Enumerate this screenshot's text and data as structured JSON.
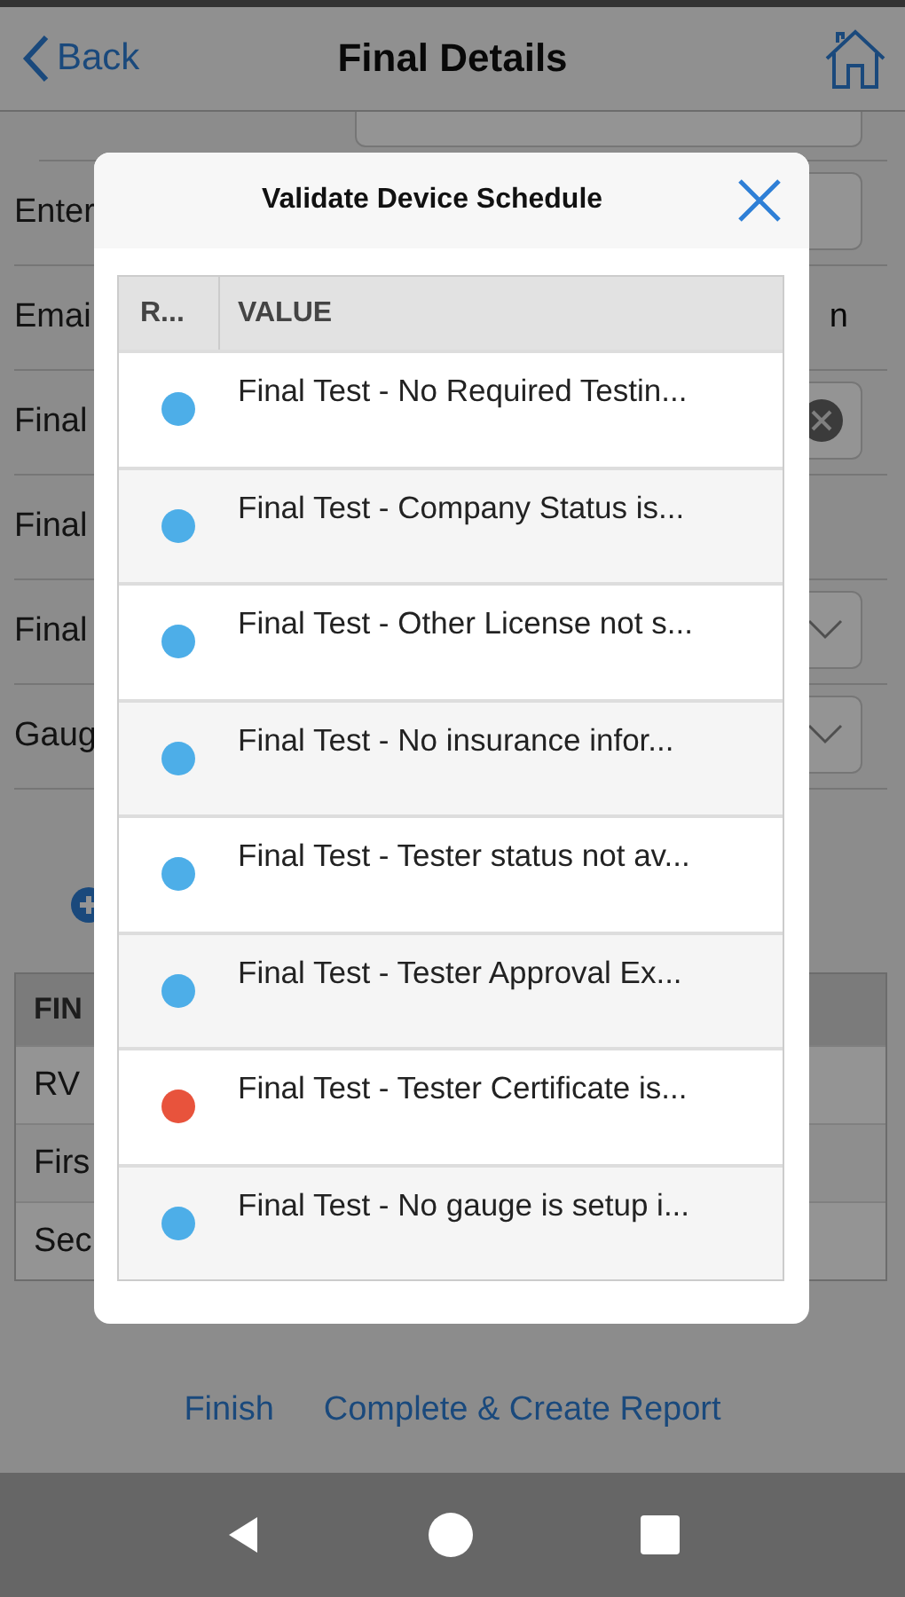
{
  "header": {
    "back": "Back",
    "title": "Final Details"
  },
  "form_rows": [
    {
      "label": "Enter",
      "kind": "field"
    },
    {
      "label": "Emai",
      "kind": "text",
      "value": "n"
    },
    {
      "label": "Final",
      "kind": "clearable"
    },
    {
      "label": "Final",
      "kind": "none"
    },
    {
      "label": "Final",
      "kind": "select"
    },
    {
      "label": "Gaug",
      "kind": "select"
    }
  ],
  "table": {
    "columns": [
      "FIN"
    ],
    "rows": [
      "RV",
      "Firs",
      "Sec"
    ]
  },
  "footer_links": [
    "Finish",
    "Complete & Create Report"
  ],
  "dialog": {
    "title": "Validate Device Schedule",
    "columns": [
      "R...",
      "VALUE"
    ],
    "rows": [
      {
        "color": "#4daee8",
        "value": "Final Test - No Required Testin..."
      },
      {
        "color": "#4daee8",
        "value": "Final Test - Company Status is..."
      },
      {
        "color": "#4daee8",
        "value": "Final Test - Other License not s..."
      },
      {
        "color": "#4daee8",
        "value": "Final Test - No insurance infor..."
      },
      {
        "color": "#4daee8",
        "value": "Final Test - Tester status not av..."
      },
      {
        "color": "#4daee8",
        "value": "Final Test - Tester Approval Ex..."
      },
      {
        "color": "#e8533c",
        "value": "Final Test - Tester Certificate is..."
      },
      {
        "color": "#4daee8",
        "value": "Final Test - No gauge is setup i..."
      }
    ]
  }
}
